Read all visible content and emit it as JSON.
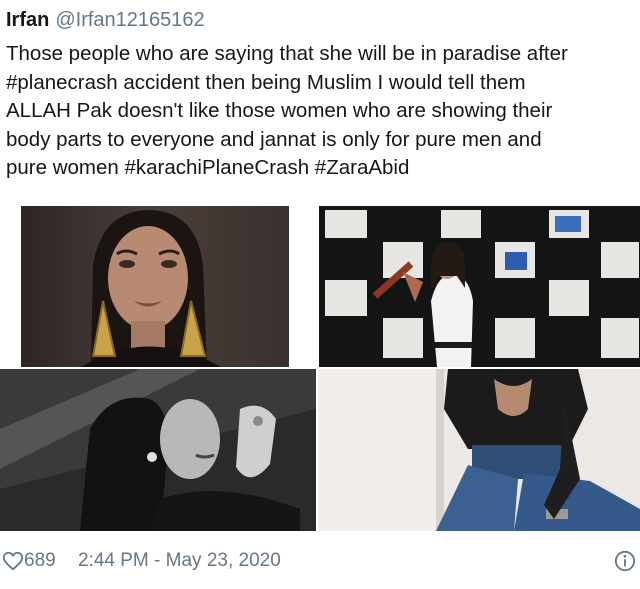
{
  "tweet": {
    "author_name": "Irfan",
    "author_handle": "@Irfan12165162",
    "text_lines": [
      "Those people who are saying that she will be in paradise after",
      "#planecrash accident then being Muslim I would tell them",
      "ALLAH Pak doesn't like those women who are showing their",
      "body parts to everyone and jannat is only for pure  men and",
      "pure women #karachiPlaneCrash #ZaraAbid"
    ],
    "likes": "689",
    "timestamp": "2:44 PM - May 23, 2020"
  },
  "icons": {
    "like": "heart-icon",
    "info": "info-icon"
  },
  "colors": {
    "text": "#14171a",
    "secondary": "#657786",
    "background": "#ffffff"
  }
}
